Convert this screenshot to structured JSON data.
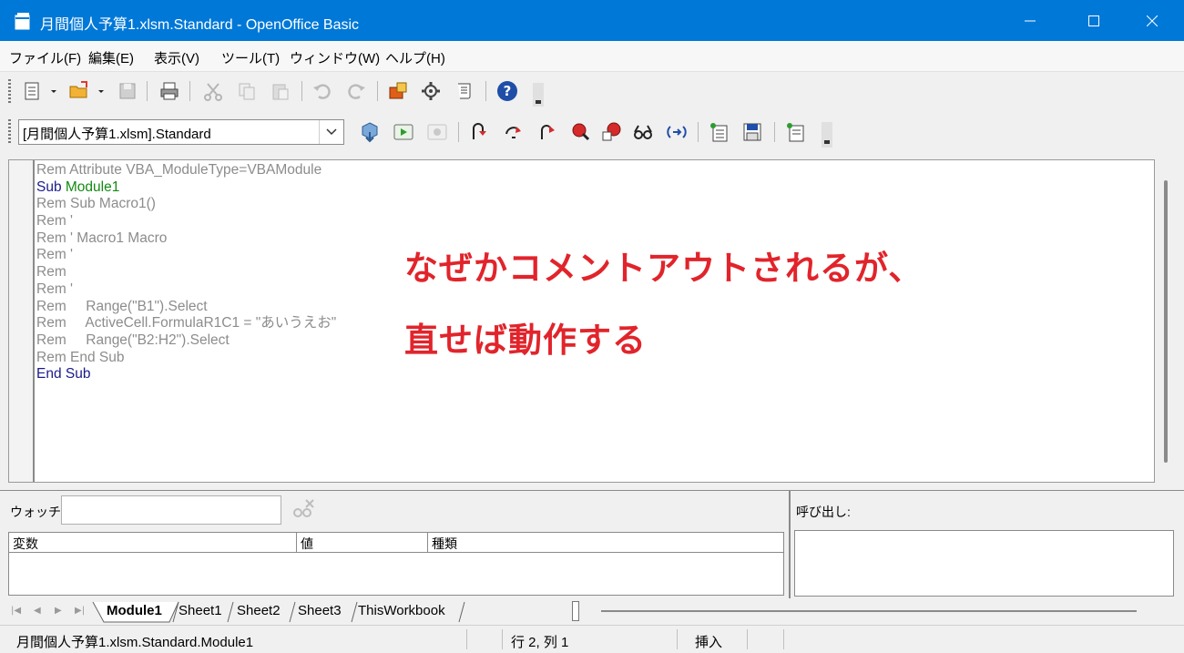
{
  "window": {
    "title": "月間個人予算1.xlsm.Standard - OpenOffice Basic"
  },
  "menu": {
    "items": [
      "ファイル(F)",
      "編集(E)",
      "表示(V)",
      "ツール(T)",
      "ウィンドウ(W)",
      "ヘルプ(H)"
    ]
  },
  "library_combo": {
    "value": "[月間個人予算1.xlsm].Standard"
  },
  "code": {
    "lines": [
      {
        "parts": [
          {
            "t": "Rem Attribute VBA_ModuleType=VBAModule",
            "c": "rem"
          }
        ]
      },
      {
        "parts": [
          {
            "t": "Sub ",
            "c": "kw"
          },
          {
            "t": "Module1",
            "c": "id"
          }
        ]
      },
      {
        "parts": [
          {
            "t": "Rem Sub Macro1()",
            "c": "rem"
          }
        ]
      },
      {
        "parts": [
          {
            "t": "Rem '",
            "c": "rem"
          }
        ]
      },
      {
        "parts": [
          {
            "t": "Rem ' Macro1 Macro",
            "c": "rem"
          }
        ]
      },
      {
        "parts": [
          {
            "t": "Rem '",
            "c": "rem"
          }
        ]
      },
      {
        "parts": [
          {
            "t": "Rem",
            "c": "rem"
          }
        ]
      },
      {
        "parts": [
          {
            "t": "Rem '",
            "c": "rem"
          }
        ]
      },
      {
        "parts": [
          {
            "t": "Rem     Range(\"B1\").Select",
            "c": "rem"
          }
        ]
      },
      {
        "parts": [
          {
            "t": "Rem     ActiveCell.FormulaR1C1 = \"あいうえお\"",
            "c": "rem"
          }
        ]
      },
      {
        "parts": [
          {
            "t": "Rem     Range(\"B2:H2\").Select",
            "c": "rem"
          }
        ]
      },
      {
        "parts": [
          {
            "t": "Rem End Sub",
            "c": "rem"
          }
        ]
      },
      {
        "parts": [
          {
            "t": "End Sub",
            "c": "kw"
          }
        ]
      }
    ]
  },
  "annotation": {
    "line1": "なぜかコメントアウトされるが、",
    "line2": "直せば動作する"
  },
  "watch": {
    "label": "ウォッチ:",
    "value": "",
    "columns": [
      "変数",
      "値",
      "種類"
    ]
  },
  "calls": {
    "label": "呼び出し:"
  },
  "tabs": [
    "Module1",
    "Sheet1",
    "Sheet2",
    "Sheet3",
    "ThisWorkbook"
  ],
  "status": {
    "module": "月間個人予算1.xlsm.Standard.Module1",
    "position": "行 2, 列 1",
    "mode": "挿入"
  },
  "colors": {
    "titlebar": "#0078d7",
    "annotation": "#e1242b",
    "comment": "#8c8c8c",
    "keyword": "#1b1b8a",
    "identifier": "#138a13"
  }
}
